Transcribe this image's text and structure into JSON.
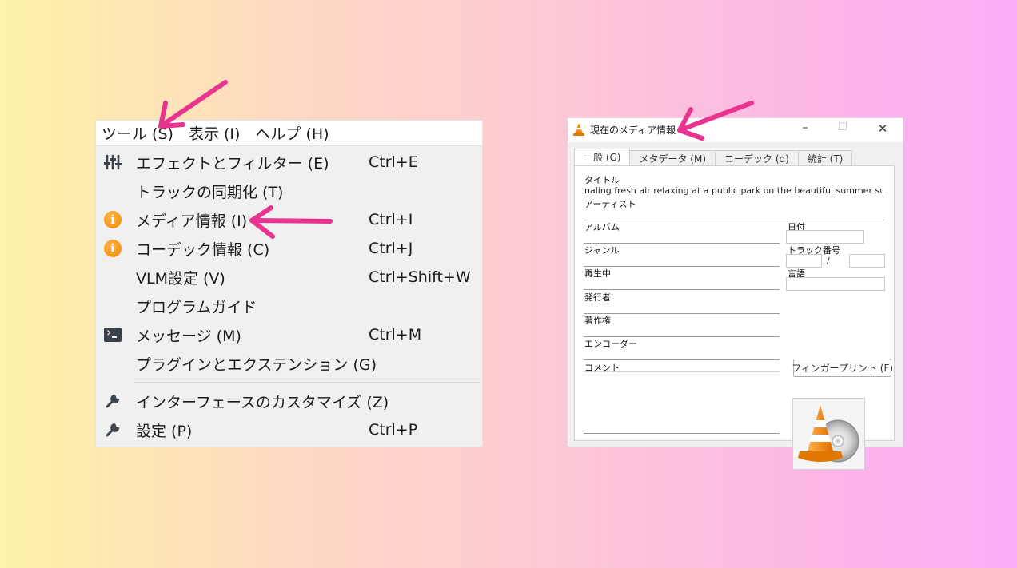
{
  "menubar": {
    "items": [
      "ツール (S)",
      "表示 (I)",
      "ヘルプ (H)"
    ]
  },
  "tools_menu": {
    "items": [
      {
        "label": "エフェクトとフィルター (E)",
        "shortcut": "Ctrl+E",
        "icon": "equalizer-icon"
      },
      {
        "label": "トラックの同期化 (T)",
        "shortcut": "",
        "icon": ""
      },
      {
        "label": "メディア情報 (I)",
        "shortcut": "Ctrl+I",
        "icon": "info-icon"
      },
      {
        "label": "コーデック情報 (C)",
        "shortcut": "Ctrl+J",
        "icon": "info-icon"
      },
      {
        "label": "VLM設定 (V)",
        "shortcut": "Ctrl+Shift+W",
        "icon": ""
      },
      {
        "label": "プログラムガイド",
        "shortcut": "",
        "icon": ""
      },
      {
        "label": "メッセージ (M)",
        "shortcut": "Ctrl+M",
        "icon": "terminal-icon"
      },
      {
        "label": "プラグインとエクステンション (G)",
        "shortcut": "",
        "icon": ""
      },
      {
        "label": "インターフェースのカスタマイズ (Z)",
        "shortcut": "",
        "icon": "wrench-icon"
      },
      {
        "label": "設定 (P)",
        "shortcut": "Ctrl+P",
        "icon": "wrench-icon"
      }
    ]
  },
  "media_info": {
    "title": "現在のメディア情報",
    "controls": {
      "minimize": "–",
      "maximize": "☐",
      "close": "✕"
    },
    "tabs": [
      "一般 (G)",
      "メタデータ (M)",
      "コーデック (d)",
      "統計 (T)"
    ],
    "labels": {
      "title": "タイトル",
      "artist": "アーティスト",
      "album": "アルバム",
      "date": "日付",
      "genre": "ジャンル",
      "track_number": "トラック番号",
      "now_playing": "再生中",
      "language": "言語",
      "publisher": "発行者",
      "copyright": "著作権",
      "encoder": "エンコーダー",
      "comment": "コメント"
    },
    "values": {
      "title": "naling fresh air relaxing at a public park on the beautiful summer sunset.",
      "track_separator": "/"
    },
    "fingerprint_button": "フィンガープリント (F)"
  },
  "colors": {
    "arrow": "#e8348e",
    "vlc_orange": "#f28a12"
  }
}
